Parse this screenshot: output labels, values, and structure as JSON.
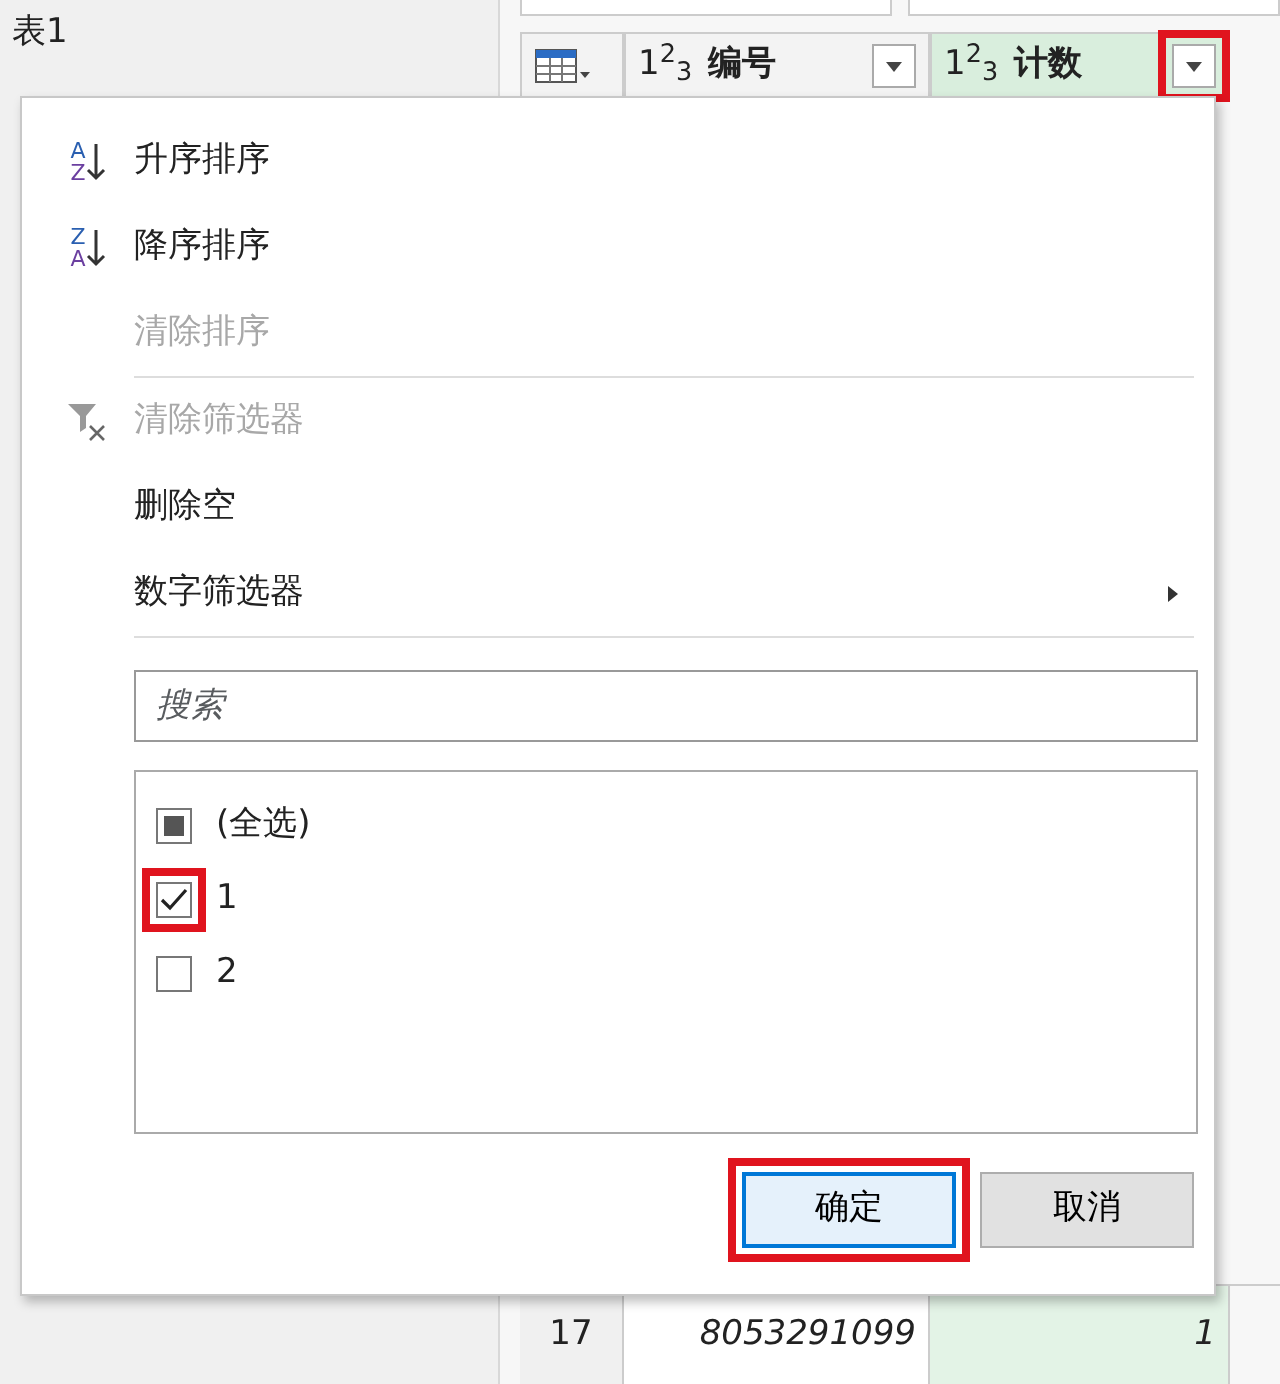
{
  "query_pane": {
    "title": "表1"
  },
  "columns": [
    {
      "kind": "table"
    },
    {
      "kind": "number",
      "label": "编号",
      "type_icon": "1$^{2}$$_{3}$",
      "highlighted": false,
      "selected": false
    },
    {
      "kind": "number",
      "label": "计数",
      "type_icon": "1$^{2}$$_{3}$",
      "highlighted": true,
      "selected": true
    }
  ],
  "rows": [
    {
      "index": "17",
      "cells": [
        "8053291099",
        "1"
      ]
    }
  ],
  "menu": {
    "items": [
      {
        "kind": "sort",
        "label": "升序排序",
        "icon_top": "A",
        "icon_bottom": "Z",
        "disabled": false
      },
      {
        "kind": "sort",
        "label": "降序排序",
        "icon_top": "Z",
        "icon_bottom": "A",
        "disabled": false
      },
      {
        "kind": "plain",
        "label": "清除排序",
        "disabled": true
      },
      {
        "kind": "separator"
      },
      {
        "kind": "clear-filter",
        "label": "清除筛选器",
        "disabled": true
      },
      {
        "kind": "plain",
        "label": "删除空",
        "disabled": false
      },
      {
        "kind": "submenu",
        "label": "数字筛选器",
        "disabled": false
      },
      {
        "kind": "separator"
      }
    ],
    "search": {
      "placeholder": "搜索"
    },
    "values": [
      {
        "label": "(全选)",
        "checked": false,
        "mixed": true,
        "highlighted": false
      },
      {
        "label": "1",
        "checked": true,
        "highlighted": true
      },
      {
        "label": "2",
        "checked": false,
        "highlighted": false
      }
    ],
    "buttons": [
      {
        "label": "确定",
        "primary": true,
        "highlighted": true
      },
      {
        "label": "取消",
        "primary": false,
        "highlighted": false
      }
    ]
  }
}
